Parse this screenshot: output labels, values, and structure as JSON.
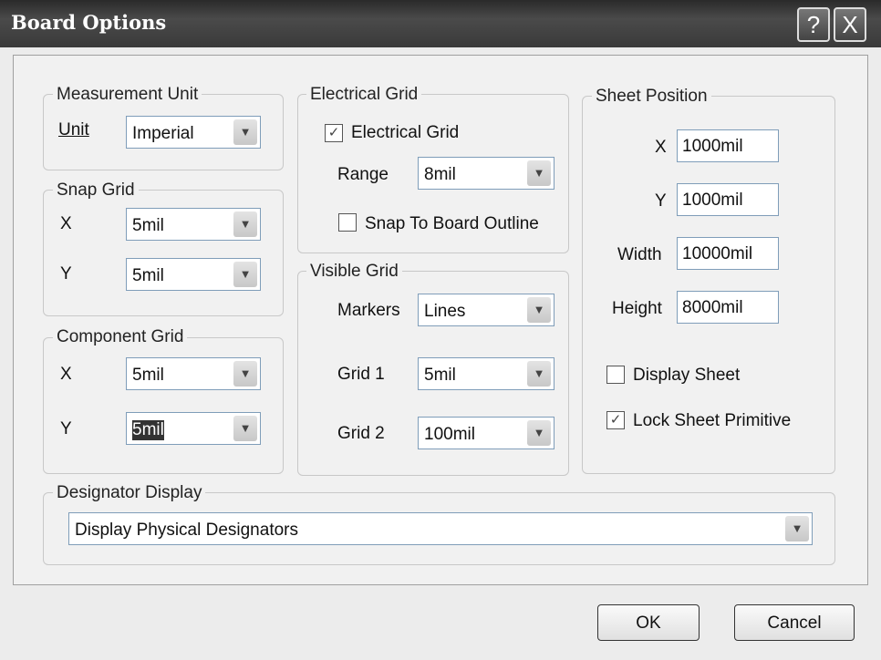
{
  "window": {
    "title": "Board Options",
    "help": "?",
    "close": "X"
  },
  "measurement": {
    "title": "Measurement Unit",
    "unit_label": "Unit",
    "unit_value": "Imperial"
  },
  "snap": {
    "title": "Snap Grid",
    "x_label": "X",
    "x_value": "5mil",
    "y_label": "Y",
    "y_value": "5mil"
  },
  "component": {
    "title": "Component Grid",
    "x_label": "X",
    "x_value": "5mil",
    "y_label": "Y",
    "y_value": "5mil"
  },
  "electrical": {
    "title": "Electrical Grid",
    "check_label": "Electrical Grid",
    "checked": true,
    "range_label": "Range",
    "range_value": "8mil",
    "snap_label": "Snap To Board Outline",
    "snap_checked": false
  },
  "visible": {
    "title": "Visible Grid",
    "markers_label": "Markers",
    "markers_value": "Lines",
    "grid1_label": "Grid 1",
    "grid1_value": "5mil",
    "grid2_label": "Grid 2",
    "grid2_value": "100mil"
  },
  "sheet": {
    "title": "Sheet Position",
    "x_label": "X",
    "x_value": "1000mil",
    "y_label": "Y",
    "y_value": "1000mil",
    "width_label": "Width",
    "width_value": "10000mil",
    "height_label": "Height",
    "height_value": "8000mil",
    "display_label": "Display Sheet",
    "display_checked": false,
    "lock_label": "Lock Sheet Primitive",
    "lock_checked": true
  },
  "designator": {
    "title": "Designator Display",
    "value": "Display Physical Designators"
  },
  "buttons": {
    "ok": "OK",
    "cancel": "Cancel"
  },
  "icons": {
    "check": "✓",
    "arrow": "⌄"
  }
}
